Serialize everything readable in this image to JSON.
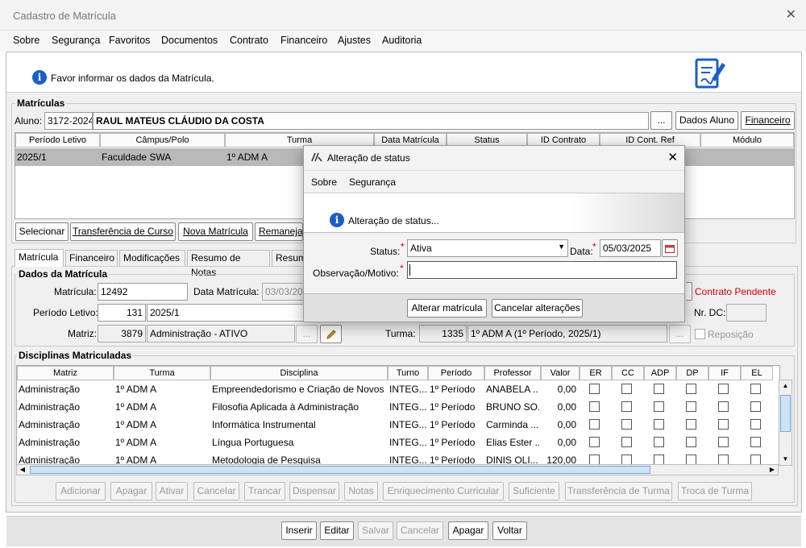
{
  "window": {
    "title": "Cadastro de Matrícula"
  },
  "menu": [
    "Sobre",
    "Segurança",
    "Favoritos",
    "Documentos",
    "Contrato",
    "Financeiro",
    "Ajustes",
    "Auditoria"
  ],
  "info": {
    "message": "Favor informar os dados da Matrícula."
  },
  "matriculas": {
    "label": "Matrículas",
    "aluno_label": "Aluno:",
    "aluno_codigo": "3172-2024",
    "aluno_nome": "RAUL MATEUS CLÁUDIO DA COSTA",
    "ellipsis": "...",
    "dados_aluno": "Dados Aluno",
    "financeiro": "Financeiro",
    "columns": [
      "Período Letivo",
      "Câmpus/Polo",
      "Turma",
      "Data Matrícula",
      "Status",
      "ID Contrato",
      "ID Cont. Ref",
      "Módulo"
    ],
    "row": [
      "2025/1",
      "Faculdade SWA",
      "1º ADM A"
    ],
    "buttons": [
      "Selecionar",
      "Transferência de Curso",
      "Nova Matrícula",
      "Remanejar"
    ]
  },
  "tabs": [
    "Matrícula",
    "Financeiro",
    "Modificações",
    "Resumo de Notas",
    "Resum"
  ],
  "dados": {
    "label": "Dados da Matrícula",
    "matricula_label": "Matrícula:",
    "matricula": "12492",
    "data_label": "Data Matrícula:",
    "data": "03/03/2025",
    "periodo_label": "Período Letivo:",
    "periodo_cod": "131",
    "periodo": "2025/1",
    "matriz_label": "Matriz:",
    "matriz_cod": "3879",
    "matriz": "Administração - ATIVO",
    "turma_label": "Turma:",
    "turma_cod": "1335",
    "turma": "1º ADM A (1º Período, 2025/1)",
    "contrato": "Contrato Pendente",
    "nrdc_label": "Nr. DC:",
    "reposicao": "Reposição",
    "ellipsis": "..."
  },
  "disciplinas": {
    "label": "Disciplinas Matriculadas",
    "columns": [
      "Matriz",
      "Turma",
      "Disciplina",
      "Turno",
      "Período",
      "Professor",
      "Valor",
      "ER",
      "CC",
      "ADP",
      "DP",
      "IF",
      "EL"
    ],
    "rows": [
      [
        "Administração",
        "1º ADM A",
        "Empreendedorismo e Criação de Novos N",
        "INTEG...",
        "1º Período",
        "ANABELA ...",
        "0,00"
      ],
      [
        "Administração",
        "1º ADM A",
        "Filosofia Aplicada à Administração",
        "INTEG...",
        "1º Período",
        "BRUNO SO...",
        "0,00"
      ],
      [
        "Administração",
        "1º ADM A",
        "Informática Instrumental",
        "INTEG...",
        "1º Período",
        "Carminda ...",
        "0,00"
      ],
      [
        "Administração",
        "1º ADM A",
        "Língua Portuguesa",
        "INTEG...",
        "1º Período",
        "Elias Ester ...",
        "0,00"
      ],
      [
        "Administração",
        "1º ADM A",
        "Metodologia de Pesquisa",
        "INTEG...",
        "1º Período",
        "DINIS OLI...",
        "120,00"
      ]
    ],
    "buttons": [
      "Adicionar",
      "Apagar",
      "Ativar",
      "Cancelar",
      "Trancar",
      "Dispensar",
      "Notas",
      "Enriquecimento Curricular",
      "Suficiente",
      "Transferência de Turma",
      "Troca de Turma"
    ]
  },
  "bottom": [
    "Inserir",
    "Editar",
    "Salvar",
    "Cancelar",
    "Apagar",
    "Voltar"
  ],
  "dialog": {
    "title": "Alteração de status",
    "menu": [
      "Sobre",
      "Segurança"
    ],
    "info": "Alteração de status...",
    "status_label": "Status:",
    "status_value": "Ativa",
    "data_label": "Data:",
    "data_value": "05/03/2025",
    "obs_label": "Observação/Motivo:",
    "obs_value": "",
    "alterar": "Alterar matrícula",
    "cancelar": "Cancelar alterações"
  },
  "colors": {
    "accent": "#1b5fc6",
    "required": "#d00000",
    "selected_row": "#b9b9b9"
  }
}
